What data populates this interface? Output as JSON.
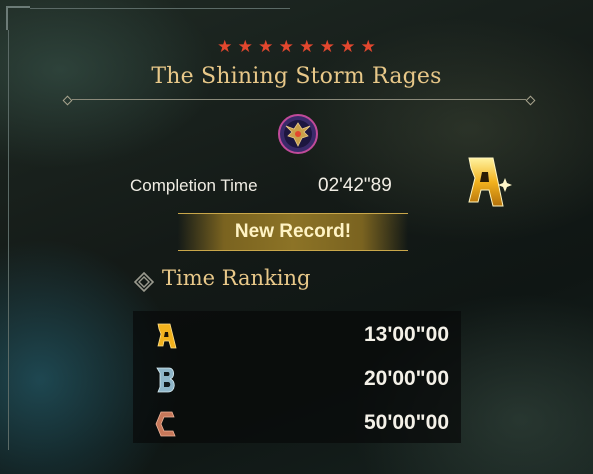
{
  "quest": {
    "stars": [
      "★",
      "★",
      "★",
      "★",
      "★",
      "★",
      "★",
      "★"
    ],
    "title": "The Shining Storm Rages",
    "emblem_icon": "monster-emblem-icon"
  },
  "result": {
    "completion_label": "Completion Time",
    "completion_time": "02'42\"89",
    "grade": "A",
    "grade_icon": "rank-a-icon",
    "new_record": "New Record!"
  },
  "time_ranking": {
    "heading": "Time Ranking",
    "heading_icon": "ranking-icon",
    "rows": [
      {
        "rank": "A",
        "icon": "rank-a-icon",
        "time": "13'00\"00",
        "color": "#f2b21e"
      },
      {
        "rank": "B",
        "icon": "rank-b-icon",
        "time": "20'00\"00",
        "color": "#8fb6c9"
      },
      {
        "rank": "C",
        "icon": "rank-c-icon",
        "time": "50'00\"00",
        "color": "#c7785a"
      }
    ]
  },
  "colors": {
    "title": "#e8c889",
    "star": "#e3472e",
    "record_bar": "#8c7326"
  }
}
